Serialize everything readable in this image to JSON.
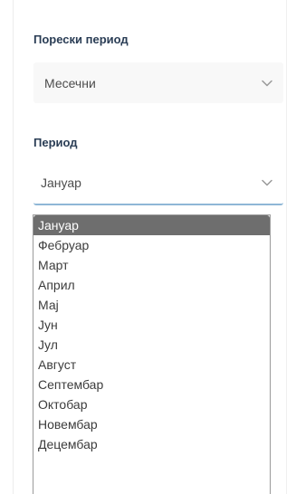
{
  "tax_period": {
    "label": "Порески период",
    "value": "Месечни"
  },
  "period": {
    "label": "Период",
    "value": "Јануар",
    "options": [
      "Јануар",
      "Фебруар",
      "Март",
      "Април",
      "Мај",
      "Јун",
      "Јул",
      "Август",
      "Септембар",
      "Октобар",
      "Новембар",
      "Децембар"
    ],
    "selected_index": 0
  },
  "icons": {
    "select_arrow": "chevron-down-icon"
  },
  "colors": {
    "label_text": "#2a3d55",
    "focus_underline": "#8fb7d6",
    "selected_option_bg": "#6e6e6e"
  }
}
